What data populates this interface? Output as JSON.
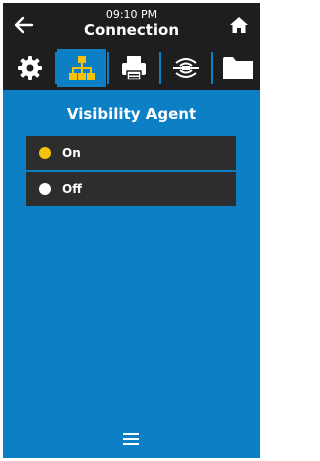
{
  "header": {
    "time": "09:10 PM",
    "title": "Connection",
    "back_icon": "back-arrow-icon",
    "home_icon": "home-icon"
  },
  "tabs": [
    {
      "icon": "gear-icon",
      "active": false
    },
    {
      "icon": "network-icon",
      "active": true
    },
    {
      "icon": "printer-icon",
      "active": false
    },
    {
      "icon": "rfid-icon",
      "active": false
    },
    {
      "icon": "folder-icon",
      "active": false
    }
  ],
  "panel": {
    "title": "Visibility Agent",
    "options": [
      {
        "label": "On",
        "selected": true
      },
      {
        "label": "Off",
        "selected": false
      }
    ]
  },
  "footer": {
    "menu_icon": "hamburger-menu-icon"
  },
  "colors": {
    "background": "#0d7fc5",
    "bar": "#1e1e1e",
    "option_bg": "#2d2d2d",
    "selected_radio": "#f4c20d",
    "unselected_radio": "#ffffff",
    "network_icon_active": "#f4c20d"
  }
}
